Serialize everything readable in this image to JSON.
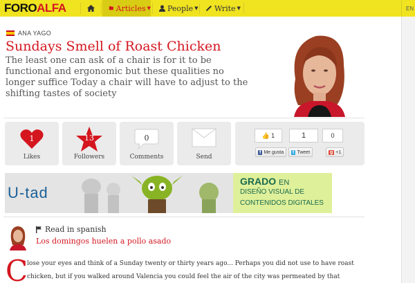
{
  "nav": {
    "logo_part1": "FORO",
    "logo_part2": "ALFA",
    "items": [
      {
        "label": "Articles"
      },
      {
        "label": "People"
      },
      {
        "label": "Write"
      }
    ],
    "lang": "EN"
  },
  "article": {
    "author": "ANA YAGO",
    "title": "Sundays Smell of Roast Chicken",
    "subtitle": "The least one can ask of a chair is for it to be functional and ergonomic but these qualities no longer suffice Today a chair will have to adjust to the shifting tastes of society",
    "body_dropcap": "C",
    "body_line1": "lose your eyes and think of a Sunday twenty or thirty years ago... Perhaps you did not use to have roast",
    "body_line2": "chicken, but if you walked around Valencia you could feel the air of the city was permeated by that"
  },
  "stats": {
    "likes_count": "1",
    "likes_label": "Likes",
    "followers_count": "13",
    "followers_label": "Followers",
    "comments_count": "0",
    "comments_label": "Comments",
    "send_label": "Send"
  },
  "social": {
    "fb_count": "1",
    "tw_count": "1",
    "gplus_count": "0",
    "fb_button": "Me gusta",
    "tw_button": "Tweet",
    "gplus_button": "+1"
  },
  "banner": {
    "brand": "U-tad",
    "line1_bold": "GRADO",
    "line1_small": "EN",
    "line2": "DISEÑO VISUAL DE",
    "line3": "CONTENIDOS DIGITALES"
  },
  "translation": {
    "label": "Read in spanish",
    "link": "Los domingos huelen a pollo asado"
  },
  "colors": {
    "brand_yellow": "#f0e320",
    "brand_red": "#d4161f"
  }
}
